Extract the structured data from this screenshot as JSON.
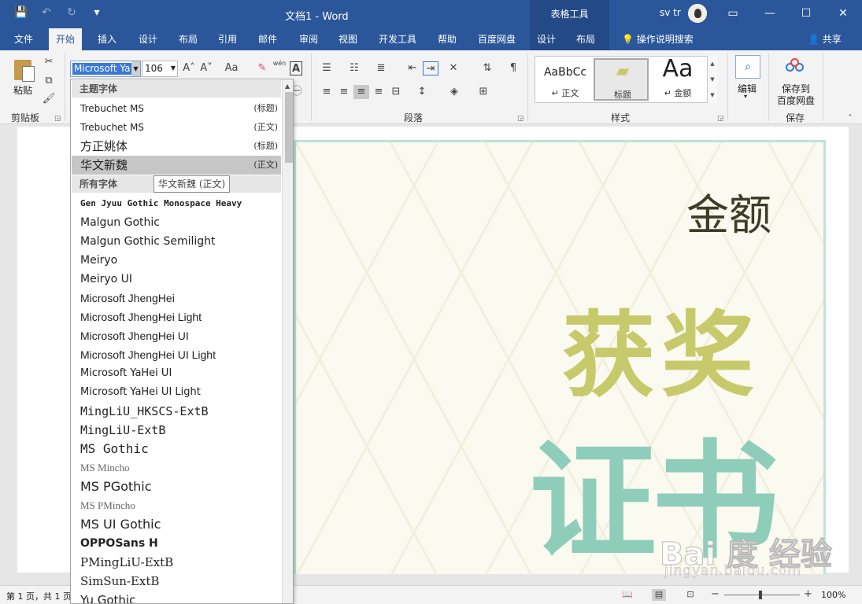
{
  "titlebar": {
    "doc_title": "文档1  -  Word",
    "context_group": "表格工具",
    "user_name": "sv tr",
    "qat": {
      "save": "💾",
      "undo": "↶",
      "redo": "↻",
      "customize": "▾"
    },
    "min": "—",
    "restore": "❐",
    "max": "☐",
    "close": "✕",
    "ribbon_display": "▭"
  },
  "tabs": [
    {
      "label": "文件"
    },
    {
      "label": "开始"
    },
    {
      "label": "插入"
    },
    {
      "label": "设计"
    },
    {
      "label": "布局"
    },
    {
      "label": "引用"
    },
    {
      "label": "邮件"
    },
    {
      "label": "审阅"
    },
    {
      "label": "视图"
    },
    {
      "label": "开发工具"
    },
    {
      "label": "帮助"
    },
    {
      "label": "百度网盘"
    },
    {
      "label": "设计"
    },
    {
      "label": "布局"
    }
  ],
  "search_label": "操作说明搜索",
  "share_label": "共享",
  "ribbon": {
    "paste_label": "粘贴",
    "clipboard_label": "剪贴板",
    "font_name": "Microsoft Ya",
    "font_size": "106",
    "grow_font": "A˄",
    "shrink_font": "A˅",
    "change_case": "Aa",
    "phonetic": "wén",
    "char_border": "A",
    "paragraph_label": "段落",
    "styles_label": "样式",
    "styles": [
      {
        "sample": "AaBbCc",
        "name": "↵ 正文"
      },
      {
        "sample": "▰",
        "name": "标题"
      },
      {
        "sample": "Aa",
        "name": "↵ 金额"
      }
    ],
    "edit_label": "编辑",
    "save_baidu_label_1": "保存到",
    "save_baidu_label_2": "百度网盘",
    "save_group_label": "保存"
  },
  "certificate": {
    "amount": "金额",
    "award": "获奖",
    "title": "证书",
    "colors": {
      "border": "#bfe2da",
      "award": "#c7ca6b",
      "title": "#8fcdbb",
      "amount": "#3d3d28"
    }
  },
  "watermark": {
    "logo": "Bai 度 经验",
    "url": "jingyan.baidu.com"
  },
  "font_dropdown": {
    "theme_header": "主题字体",
    "theme_fonts": [
      {
        "name": "Trebuchet MS",
        "tag": "(标题)"
      },
      {
        "name": "Trebuchet MS",
        "tag": "(正文)"
      },
      {
        "name": "方正姚体",
        "tag": "(标题)"
      },
      {
        "name": "华文新魏",
        "tag": "(正文)"
      }
    ],
    "all_header": "所有字体",
    "all_fonts": [
      "Gen Jyuu Gothic Monospace Heavy",
      "Malgun Gothic",
      "Malgun Gothic Semilight",
      "Meiryo",
      "Meiryo UI",
      "Microsoft JhengHei",
      "Microsoft JhengHei Light",
      "Microsoft JhengHei UI",
      "Microsoft JhengHei UI Light",
      "Microsoft YaHei UI",
      "Microsoft YaHei UI Light",
      "MingLiU_HKSCS-ExtB",
      "MingLiU-ExtB",
      "MS Gothic",
      "MS Mincho",
      "MS PGothic",
      "MS PMincho",
      "MS UI Gothic",
      "OPPOSans H",
      "PMingLiU-ExtB",
      "SimSun-ExtB",
      "Yu Gothic"
    ],
    "tooltip": "华文新魏 (正文)"
  },
  "status": {
    "page_info": "第 1 页，共 1 页",
    "zoom": "100%",
    "zoom_minus": "−",
    "zoom_plus": "+"
  }
}
